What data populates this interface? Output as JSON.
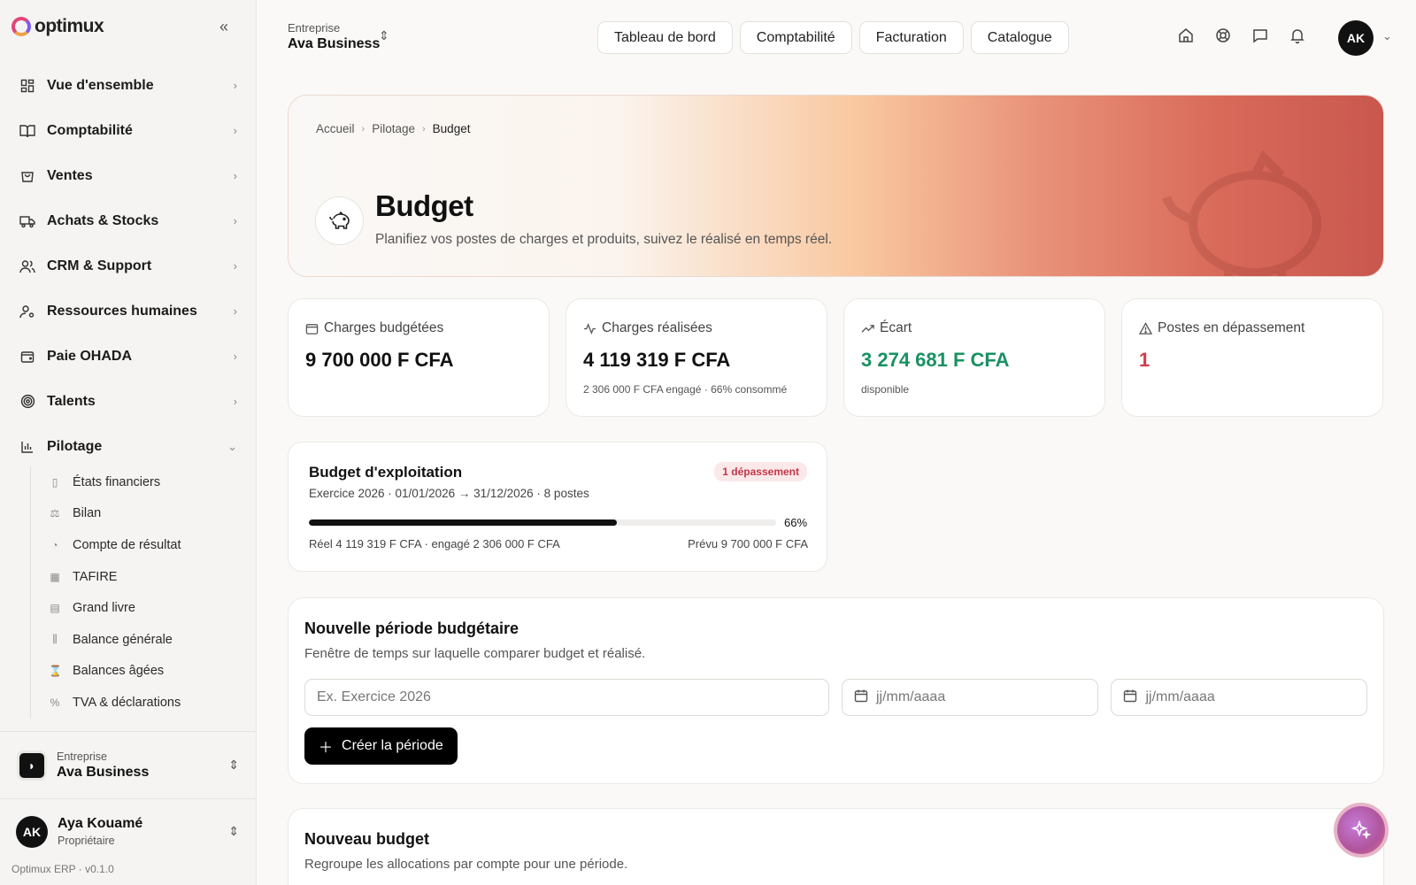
{
  "app": {
    "brand": "optimux",
    "version": "Optimux ERP · v0.1.0"
  },
  "sidebar": {
    "items": [
      {
        "label": "Vue d'ensemble",
        "icon": "grid-icon"
      },
      {
        "label": "Comptabilité",
        "icon": "book-icon"
      },
      {
        "label": "Ventes",
        "icon": "bag-icon"
      },
      {
        "label": "Achats & Stocks",
        "icon": "truck-icon"
      },
      {
        "label": "CRM & Support",
        "icon": "users-icon"
      },
      {
        "label": "Ressources humaines",
        "icon": "user-cog-icon"
      },
      {
        "label": "Paie OHADA",
        "icon": "wallet-icon"
      },
      {
        "label": "Talents",
        "icon": "target-icon"
      },
      {
        "label": "Pilotage",
        "icon": "bar-chart-icon",
        "expanded": true
      }
    ],
    "sub_items": [
      {
        "label": "États financiers"
      },
      {
        "label": "Bilan"
      },
      {
        "label": "Compte de résultat"
      },
      {
        "label": "TAFIRE"
      },
      {
        "label": "Grand livre"
      },
      {
        "label": "Balance générale"
      },
      {
        "label": "Balances âgées"
      },
      {
        "label": "TVA & déclarations"
      }
    ],
    "company": {
      "caption": "Entreprise",
      "name": "Ava Business"
    },
    "user": {
      "initials": "AK",
      "name": "Aya Kouamé",
      "role": "Propriétaire"
    }
  },
  "topbar": {
    "company_caption": "Entreprise",
    "company_name": "Ava Business",
    "nav": [
      "Tableau de bord",
      "Comptabilité",
      "Facturation",
      "Catalogue"
    ],
    "avatar": "AK"
  },
  "hero": {
    "breadcrumb": [
      "Accueil",
      "Pilotage",
      "Budget"
    ],
    "title": "Budget",
    "subtitle": "Planifiez vos postes de charges et produits, suivez le réalisé en temps réel."
  },
  "kpis": [
    {
      "label": "Charges budgétées",
      "value": "9 700 000 F CFA",
      "note": "",
      "icon": "wallet-icon"
    },
    {
      "label": "Charges réalisées",
      "value": "4 119 319 F CFA",
      "note": "2 306 000 F CFA engagé · 66% consommé",
      "icon": "activity-icon"
    },
    {
      "label": "Écart",
      "value": "3 274 681 F CFA",
      "note": "disponible",
      "icon": "trend-up-icon",
      "color": "#1a9162"
    },
    {
      "label": "Postes en dépassement",
      "value": "1",
      "note": "",
      "icon": "alert-triangle-icon",
      "color": "#d23c4a"
    }
  ],
  "budget_card": {
    "title": "Budget d'exploitation",
    "badge": "1 dépassement",
    "meta": "Exercice 2026 · 01/01/2026 → 31/12/2026 · 8 postes",
    "progress": 0.66,
    "progress_label": "66%",
    "real": "Réel 4 119 319 F CFA · engagé 2 306 000 F CFA",
    "planned": "Prévu 9 700 000 F CFA"
  },
  "period_form": {
    "title": "Nouvelle période budgétaire",
    "subtitle": "Fenêtre de temps sur laquelle comparer budget et réalisé.",
    "name_placeholder": "Ex. Exercice 2026",
    "start_placeholder": "jj/mm/aaaa",
    "end_placeholder": "jj/mm/aaaa",
    "submit": "Créer la période"
  },
  "budget_form": {
    "title": "Nouveau budget",
    "subtitle": "Regroupe les allocations par compte pour une période."
  },
  "colors": {
    "accent": "#111111",
    "positive": "#1a9162",
    "danger": "#d23c4a",
    "fab": "#b0559d"
  }
}
